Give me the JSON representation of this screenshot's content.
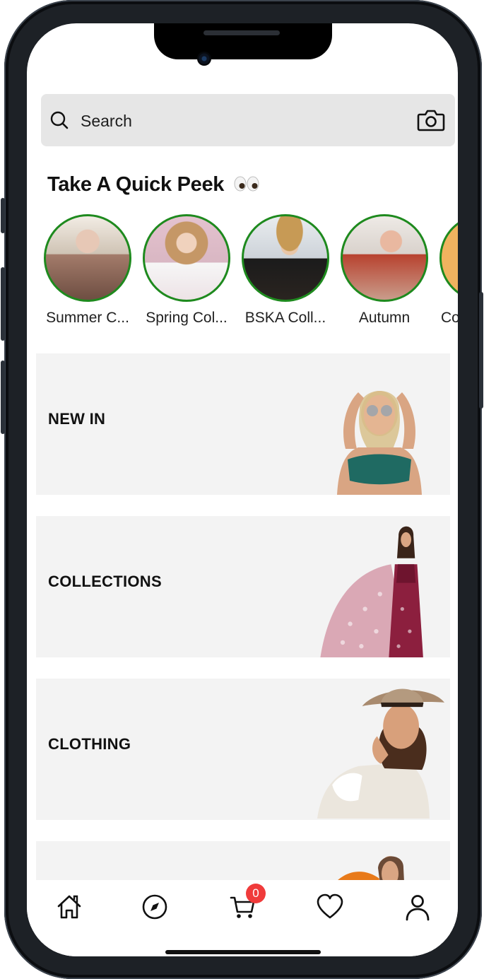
{
  "search": {
    "placeholder": "Search"
  },
  "quick_peek": {
    "title": "Take A Quick Peek",
    "emoji": "eyes-emoji",
    "stories": [
      {
        "label": "Summer C...",
        "color": "#a37b6a"
      },
      {
        "label": "Spring Col...",
        "color": "#d9b7c3"
      },
      {
        "label": "BSKA Coll...",
        "color": "#8d7a5c"
      },
      {
        "label": "Autumn",
        "color": "#c99c8b"
      },
      {
        "label": "Co",
        "color": "#f0b35f"
      }
    ]
  },
  "categories": [
    {
      "label": "NEW IN",
      "accent": "#1f6a62"
    },
    {
      "label": "COLLECTIONS",
      "accent": "#8c1f3e"
    },
    {
      "label": "CLOTHING",
      "accent": "#ebe6dd"
    },
    {
      "label": "",
      "accent": "#e87a1a"
    }
  ],
  "tab_bar": {
    "items": [
      "home-icon",
      "compass-icon",
      "cart-icon",
      "heart-icon",
      "profile-icon"
    ],
    "cart_count": "0",
    "badge_color": "#f03b3b"
  }
}
